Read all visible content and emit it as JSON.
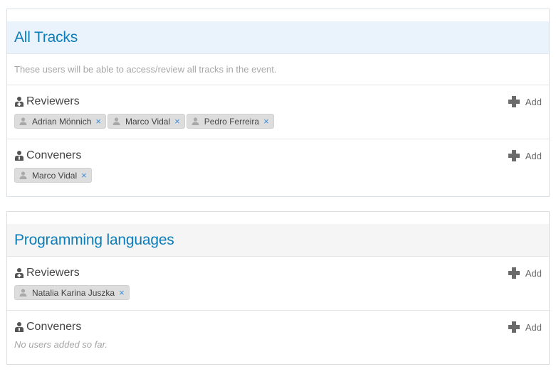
{
  "all_tracks": {
    "title": "All Tracks",
    "description": "These users will be able to access/review all tracks in the event.",
    "reviewers": {
      "label": "Reviewers",
      "add_label": "Add",
      "users": [
        "Adrian Mönnich",
        "Marco Vidal",
        "Pedro Ferreira"
      ]
    },
    "conveners": {
      "label": "Conveners",
      "add_label": "Add",
      "users": [
        "Marco Vidal"
      ]
    }
  },
  "programming_languages": {
    "title": "Programming languages",
    "reviewers": {
      "label": "Reviewers",
      "add_label": "Add",
      "users": [
        "Natalia Karina Juszka"
      ]
    },
    "conveners": {
      "label": "Conveners",
      "add_label": "Add",
      "empty_text": "No users added so far."
    }
  },
  "icons": {
    "reviewer": "reviewer-icon",
    "convener": "convener-icon",
    "add": "plus-icon",
    "user": "user-icon",
    "remove": "remove-icon"
  },
  "colors": {
    "title": "#0b7db8",
    "header_bg_first": "#eaf2fc",
    "header_bg_second": "#f5f5f5",
    "chip_bg": "#dddddd",
    "remove": "#3b8ddb"
  }
}
